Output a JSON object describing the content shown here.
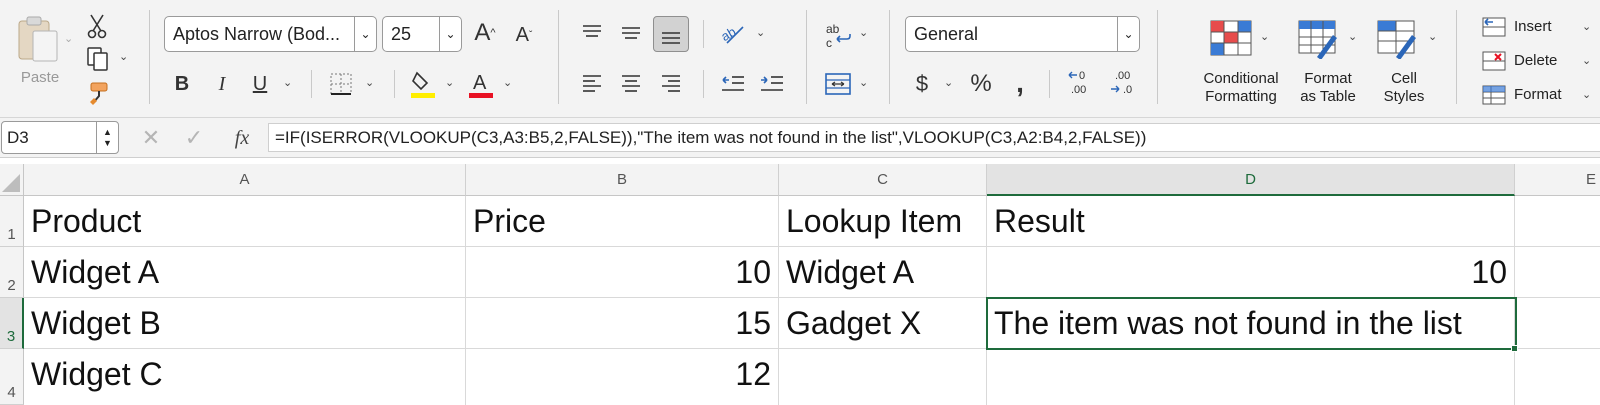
{
  "ribbon": {
    "clipboard": {
      "paste_label": "Paste"
    },
    "font": {
      "name": "Aptos Narrow (Bod...",
      "size": "25"
    },
    "number": {
      "format": "General"
    },
    "styles": {
      "conditional_formatting_line1": "Conditional",
      "conditional_formatting_line2": "Formatting",
      "format_as_table_line1": "Format",
      "format_as_table_line2": "as Table",
      "cell_styles_line1": "Cell",
      "cell_styles_line2": "Styles"
    },
    "cells": {
      "insert_label": "Insert",
      "delete_label": "Delete",
      "format_label": "Format"
    },
    "colors": {
      "highlight": "#ffee00",
      "font_color": "#e81123",
      "accent": "#1e6b3c"
    }
  },
  "formula_bar": {
    "name_box": "D3",
    "fx": "fx",
    "formula": "=IF(ISERROR(VLOOKUP(C3,A3:B5,2,FALSE)),\"The item was not found in the list\",VLOOKUP(C3,A2:B4,2,FALSE))"
  },
  "sheet": {
    "columns": [
      "A",
      "B",
      "C",
      "D",
      "E"
    ],
    "rows": [
      "1",
      "2",
      "3",
      "4"
    ],
    "cells": {
      "A1": "Product",
      "B1": "Price",
      "C1": "Lookup Item",
      "D1": "Result",
      "A2": "Widget A",
      "B2": "10",
      "C2": "Widget A",
      "D2": "10",
      "A3": "Widget B",
      "B3": "15",
      "C3": "Gadget X",
      "D3": "The item was not found in the list",
      "A4": "Widget C",
      "B4": "12",
      "C4": "",
      "D4": ""
    },
    "active_cell": "D3"
  }
}
